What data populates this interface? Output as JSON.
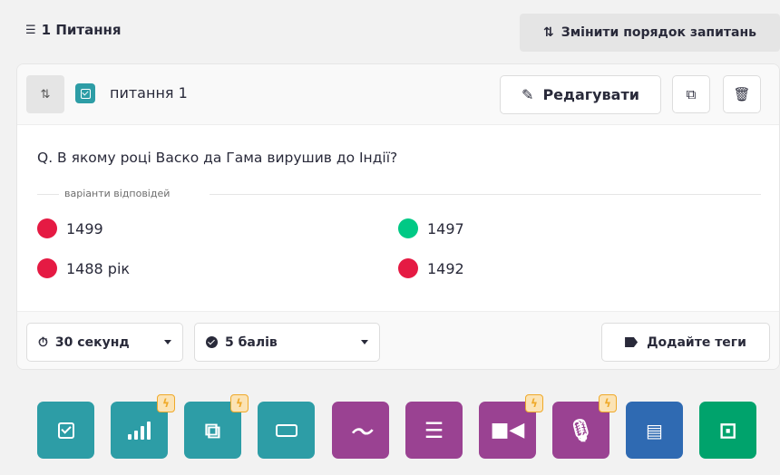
{
  "header": {
    "count_label": "1 Питання",
    "list_icon": "list-check-icon",
    "reorder_label": "Змінити порядок запитань",
    "reorder_icon": "sort-icon"
  },
  "question": {
    "label": "питання 1",
    "type_color": "#2d9da6",
    "edit_label": "Редагувати",
    "text": "Q. В якому році Васко да Гама вирушив до Індії?",
    "answers_label": "варіанти відповідей",
    "answers": [
      {
        "text": "1499",
        "status": "incorrect",
        "color": "#e51a43"
      },
      {
        "text": "1497",
        "status": "correct",
        "color": "#00c985"
      },
      {
        "text": "1488 рік",
        "status": "incorrect",
        "color": "#e51a43"
      },
      {
        "text": "1492",
        "status": "incorrect",
        "color": "#e51a43"
      }
    ],
    "time_value": "30 секунд",
    "points_value": "5 балів",
    "tags_label": "Додайте теги"
  },
  "question_types": [
    {
      "name": "multiple-choice-icon",
      "color": "#2d9da6",
      "premium": false
    },
    {
      "name": "poll-icon",
      "color": "#2d9da6",
      "premium": true
    },
    {
      "name": "match-icon",
      "color": "#2d9da6",
      "premium": true
    },
    {
      "name": "fill-blank-icon",
      "color": "#2d9da6",
      "premium": false
    },
    {
      "name": "draw-icon",
      "color": "#9a4292",
      "premium": false
    },
    {
      "name": "open-ended-icon",
      "color": "#9a4292",
      "premium": false
    },
    {
      "name": "video-icon",
      "color": "#9a4292",
      "premium": true
    },
    {
      "name": "audio-icon",
      "color": "#9a4292",
      "premium": true
    },
    {
      "name": "chart-icon",
      "color": "#2f6ab2",
      "premium": false
    },
    {
      "name": "slide-icon",
      "color": "#00a36c",
      "premium": false
    }
  ]
}
